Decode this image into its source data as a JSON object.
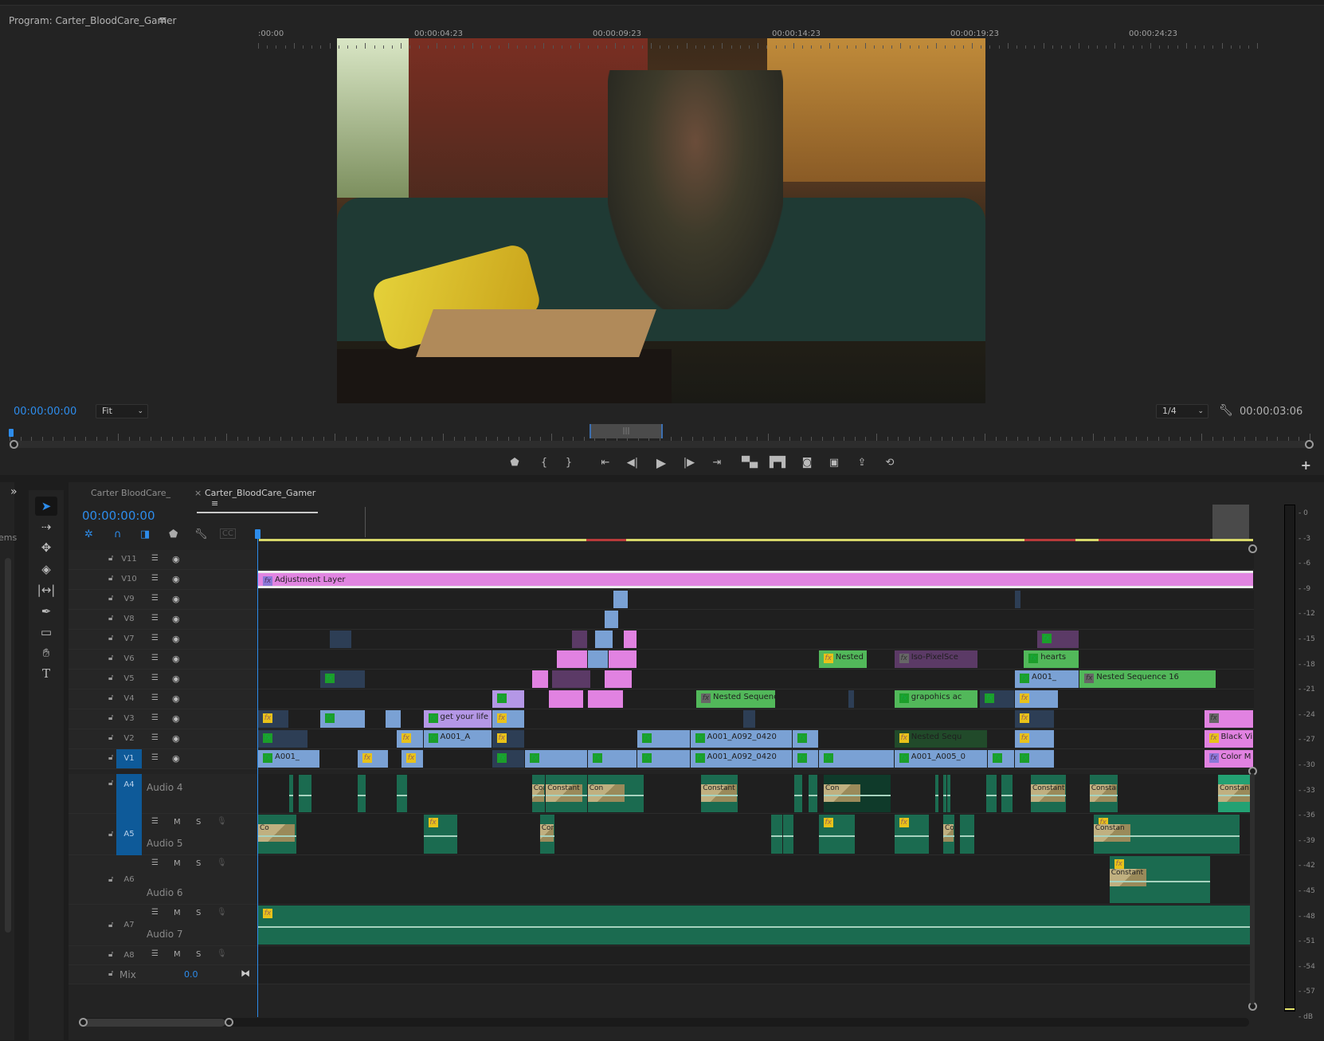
{
  "program_monitor": {
    "title": "Program: Carter_BloodCare_Gamer",
    "menu_icon": "hamburger-icon",
    "timecode_current": "00:00:00:00",
    "zoom_select": "Fit",
    "resolution_select": "1/4",
    "timecode_duration": "00:00:03:06",
    "transport_buttons": [
      "add-marker",
      "mark-in",
      "mark-out",
      "go-to-in",
      "step-back",
      "play",
      "step-forward",
      "go-to-out",
      "lift",
      "extract",
      "export-frame",
      "insert",
      "overwrite",
      "trim"
    ],
    "add_button": "+"
  },
  "left_panel": {
    "expand_icon": "»",
    "partial_label": "ems"
  },
  "tools": [
    "selection",
    "track-select-forward",
    "ripple-edit",
    "razor",
    "slip",
    "pen",
    "rectangle",
    "hand",
    "type"
  ],
  "timeline": {
    "tabs": [
      {
        "label": "Carter BloodCare_",
        "active": false
      },
      {
        "label": "Carter_BloodCare_Gamer",
        "active": true
      }
    ],
    "close_icon": "×",
    "menu_icon": "≡",
    "timecode": "00:00:00:00",
    "ruler_labels": [
      ":00:00",
      "00:00:04:23",
      "00:00:09:23",
      "00:00:14:23",
      "00:00:19:23",
      "00:00:24:23"
    ],
    "video_tracks": [
      {
        "name": "V11",
        "selected": false,
        "clips": []
      },
      {
        "name": "V10",
        "selected": false,
        "clips": [
          {
            "type": "adj",
            "start": 0,
            "end": 1,
            "label": "Adjustment Layer",
            "fx": "p"
          }
        ]
      },
      {
        "name": "V9",
        "selected": false,
        "clips": [
          {
            "type": "blue",
            "start": 0.357,
            "end": 0.372,
            "label": ""
          },
          {
            "type": "navy",
            "start": 0.76,
            "end": 0.766,
            "label": ""
          }
        ]
      },
      {
        "name": "V8",
        "selected": false,
        "clips": [
          {
            "type": "blue",
            "start": 0.348,
            "end": 0.362,
            "label": ""
          }
        ]
      },
      {
        "name": "V7",
        "selected": false,
        "clips": [
          {
            "type": "navy",
            "start": 0.072,
            "end": 0.094,
            "label": ""
          },
          {
            "type": "plum",
            "start": 0.315,
            "end": 0.331,
            "label": ""
          },
          {
            "type": "blue",
            "start": 0.338,
            "end": 0.357,
            "label": ""
          },
          {
            "type": "pink",
            "start": 0.367,
            "end": 0.381,
            "label": ""
          },
          {
            "type": "plum",
            "start": 0.782,
            "end": 0.825,
            "label": "",
            "fx": "g"
          }
        ]
      },
      {
        "name": "V6",
        "selected": false,
        "clips": [
          {
            "type": "pink",
            "start": 0.3,
            "end": 0.331,
            "label": ""
          },
          {
            "type": "blue",
            "start": 0.331,
            "end": 0.352,
            "label": ""
          },
          {
            "type": "pink",
            "start": 0.352,
            "end": 0.381,
            "label": ""
          },
          {
            "type": "green",
            "start": 0.563,
            "end": 0.612,
            "label": "Nested",
            "fx": "y"
          },
          {
            "type": "plum",
            "start": 0.639,
            "end": 0.723,
            "label": "Iso-PixelSce",
            "fx": "gr"
          },
          {
            "type": "green",
            "start": 0.769,
            "end": 0.825,
            "label": "hearts",
            "fx": "g"
          }
        ]
      },
      {
        "name": "V5",
        "selected": false,
        "clips": [
          {
            "type": "navy",
            "start": 0.062,
            "end": 0.108,
            "label": "",
            "fx": "g"
          },
          {
            "type": "pink",
            "start": 0.275,
            "end": 0.292,
            "label": ""
          },
          {
            "type": "plum",
            "start": 0.295,
            "end": 0.334,
            "label": ""
          },
          {
            "type": "pink",
            "start": 0.348,
            "end": 0.376,
            "label": ""
          },
          {
            "type": "blue",
            "start": 0.76,
            "end": 0.825,
            "label": "A001_",
            "fx": "g"
          },
          {
            "type": "green",
            "start": 0.825,
            "end": 0.962,
            "label": "Nested Sequence 16",
            "fx": "gr"
          }
        ]
      },
      {
        "name": "V4",
        "selected": false,
        "clips": [
          {
            "type": "purple",
            "start": 0.235,
            "end": 0.268,
            "label": "",
            "fx": "g"
          },
          {
            "type": "pink",
            "start": 0.292,
            "end": 0.327,
            "label": ""
          },
          {
            "type": "pink",
            "start": 0.331,
            "end": 0.367,
            "label": ""
          },
          {
            "type": "green",
            "start": 0.44,
            "end": 0.52,
            "label": "Nested Sequenc",
            "fx": "gr"
          },
          {
            "type": "navy",
            "start": 0.593,
            "end": 0.599,
            "label": ""
          },
          {
            "type": "green",
            "start": 0.639,
            "end": 0.723,
            "label": "grapohics ac",
            "fx": "g"
          },
          {
            "type": "navy",
            "start": 0.725,
            "end": 0.76,
            "label": "",
            "fx": "g"
          },
          {
            "type": "blue",
            "start": 0.76,
            "end": 0.804,
            "label": "",
            "fx": "y"
          }
        ]
      },
      {
        "name": "V3",
        "selected": false,
        "clips": [
          {
            "type": "navy",
            "start": 0,
            "end": 0.031,
            "label": "",
            "fx": "y"
          },
          {
            "type": "blue",
            "start": 0.062,
            "end": 0.108,
            "label": "",
            "fx": "g"
          },
          {
            "type": "blue",
            "start": 0.128,
            "end": 0.144,
            "label": ""
          },
          {
            "type": "purple",
            "start": 0.166,
            "end": 0.235,
            "label": "get your life",
            "fx": "g"
          },
          {
            "type": "blue",
            "start": 0.235,
            "end": 0.268,
            "label": "",
            "fx": "y"
          },
          {
            "type": "navy",
            "start": 0.487,
            "end": 0.5,
            "label": ""
          },
          {
            "type": "navy",
            "start": 0.76,
            "end": 0.8,
            "label": "",
            "fx": "y"
          },
          {
            "type": "pink",
            "start": 0.95,
            "end": 1,
            "label": "",
            "fx": "gr"
          }
        ]
      },
      {
        "name": "V2",
        "selected": false,
        "clips": [
          {
            "type": "navy",
            "start": 0,
            "end": 0.05,
            "label": "",
            "fx": "g"
          },
          {
            "type": "blue",
            "start": 0.139,
            "end": 0.166,
            "label": "",
            "fx": "y"
          },
          {
            "type": "blue",
            "start": 0.166,
            "end": 0.235,
            "label": "A001_A",
            "fx": "g"
          },
          {
            "type": "navy",
            "start": 0.235,
            "end": 0.268,
            "label": "",
            "fx": "y"
          },
          {
            "type": "blue",
            "start": 0.381,
            "end": 0.434,
            "label": "",
            "fx": "g"
          },
          {
            "type": "blue",
            "start": 0.434,
            "end": 0.537,
            "label": "A001_A092_0420",
            "fx": "g"
          },
          {
            "type": "blue",
            "start": 0.537,
            "end": 0.563,
            "label": "",
            "fx": "g"
          },
          {
            "type": "dkgreen",
            "start": 0.639,
            "end": 0.733,
            "label": "Nested Sequ",
            "fx": "y"
          },
          {
            "type": "blue",
            "start": 0.76,
            "end": 0.8,
            "label": "",
            "fx": "y"
          },
          {
            "type": "pink",
            "start": 0.95,
            "end": 1,
            "label": "Black Vi",
            "fx": "y"
          }
        ]
      },
      {
        "name": "V1",
        "selected": true,
        "clips": [
          {
            "type": "blue",
            "start": 0,
            "end": 0.062,
            "label": "A001_",
            "fx": "g"
          },
          {
            "type": "blue",
            "start": 0.1,
            "end": 0.131,
            "label": "",
            "fx": "y"
          },
          {
            "type": "blue",
            "start": 0.144,
            "end": 0.166,
            "label": "",
            "fx": "y"
          },
          {
            "type": "navy",
            "start": 0.235,
            "end": 0.268,
            "label": "",
            "fx": "g"
          },
          {
            "type": "blue",
            "start": 0.268,
            "end": 0.331,
            "label": "",
            "fx": "g"
          },
          {
            "type": "blue",
            "start": 0.331,
            "end": 0.381,
            "label": "",
            "fx": "g"
          },
          {
            "type": "blue",
            "start": 0.381,
            "end": 0.434,
            "label": "",
            "fx": "g"
          },
          {
            "type": "blue",
            "start": 0.434,
            "end": 0.537,
            "label": "A001_A092_0420",
            "fx": "g"
          },
          {
            "type": "blue",
            "start": 0.537,
            "end": 0.563,
            "label": "",
            "fx": "g"
          },
          {
            "type": "blue",
            "start": 0.563,
            "end": 0.639,
            "label": "",
            "fx": "g"
          },
          {
            "type": "blue",
            "start": 0.639,
            "end": 0.733,
            "label": "A001_A005_0",
            "fx": "g"
          },
          {
            "type": "blue",
            "start": 0.733,
            "end": 0.76,
            "label": "",
            "fx": "g"
          },
          {
            "type": "blue",
            "start": 0.76,
            "end": 0.8,
            "label": "",
            "fx": "g"
          },
          {
            "type": "pink",
            "start": 0.95,
            "end": 1,
            "label": "Color M",
            "fx": "p"
          }
        ]
      }
    ],
    "audio_tracks": [
      {
        "id": "A4",
        "name": "Audio 4",
        "selected": true,
        "show_controls": false,
        "clips": [
          {
            "start": 0.031,
            "end": 0.036
          },
          {
            "start": 0.041,
            "end": 0.054
          },
          {
            "start": 0.1,
            "end": 0.109
          },
          {
            "start": 0.139,
            "end": 0.15
          },
          {
            "start": 0.275,
            "end": 0.289,
            "trans": "Con"
          },
          {
            "start": 0.289,
            "end": 0.331,
            "trans": "Constant P"
          },
          {
            "start": 0.331,
            "end": 0.388,
            "trans": "Con"
          },
          {
            "start": 0.445,
            "end": 0.482,
            "trans": "Constant P"
          },
          {
            "start": 0.538,
            "end": 0.547
          },
          {
            "start": 0.553,
            "end": 0.562
          },
          {
            "start": 0.568,
            "end": 0.636,
            "dark": true,
            "trans": "Con"
          },
          {
            "start": 0.68,
            "end": 0.682
          },
          {
            "start": 0.688,
            "end": 0.69
          },
          {
            "start": 0.692,
            "end": 0.696
          },
          {
            "start": 0.731,
            "end": 0.742
          },
          {
            "start": 0.746,
            "end": 0.758
          },
          {
            "start": 0.776,
            "end": 0.812,
            "trans": "Constant P"
          },
          {
            "start": 0.835,
            "end": 0.864,
            "trans": "Constan"
          },
          {
            "start": 0.964,
            "end": 1,
            "trans": "Constan",
            "light": true
          }
        ]
      },
      {
        "id": "A5",
        "name": "Audio 5",
        "selected": true,
        "show_controls": true,
        "clips": [
          {
            "start": 0,
            "end": 0.039,
            "trans": "Co"
          },
          {
            "start": 0.166,
            "end": 0.201,
            "fx": true
          },
          {
            "start": 0.283,
            "end": 0.298,
            "trans": "Con"
          },
          {
            "start": 0.515,
            "end": 0.527
          },
          {
            "start": 0.527,
            "end": 0.538
          },
          {
            "start": 0.563,
            "end": 0.6,
            "fx": true
          },
          {
            "start": 0.639,
            "end": 0.674,
            "fx": true
          },
          {
            "start": 0.688,
            "end": 0.7,
            "trans": "Con"
          },
          {
            "start": 0.705,
            "end": 0.72
          },
          {
            "start": 0.839,
            "end": 0.986,
            "fx": true,
            "trans": "Constan"
          }
        ]
      },
      {
        "id": "A6",
        "name": "Audio 6",
        "selected": false,
        "show_controls": true,
        "clips": [
          {
            "start": 0.855,
            "end": 0.957,
            "fx": true,
            "trans": "Constant"
          }
        ]
      },
      {
        "id": "A7",
        "name": "Audio 7",
        "selected": false,
        "show_controls": true,
        "clips": [
          {
            "start": 0,
            "end": 1,
            "fx": true
          }
        ]
      },
      {
        "id": "A8",
        "name": "",
        "selected": false,
        "show_controls": true,
        "clips": []
      }
    ],
    "mix": {
      "label": "Mix",
      "value": "0.0"
    },
    "track_buttons": {
      "mute": "M",
      "solo": "S"
    }
  },
  "audio_meter": {
    "labels": [
      "0",
      "-3",
      "-6",
      "-9",
      "-12",
      "-15",
      "-18",
      "-21",
      "-24",
      "-27",
      "-30",
      "-33",
      "-36",
      "-39",
      "-42",
      "-45",
      "-48",
      "-51",
      "-54",
      "-57",
      "dB"
    ]
  },
  "colors": {
    "accent": "#2d8ceb",
    "clip_blue": "#7aa1d4",
    "clip_pink": "#e182e1",
    "clip_green": "#52b85a",
    "audio": "#1b6b50",
    "work_area": "#d8d86a",
    "render_red": "#b83a3a"
  }
}
